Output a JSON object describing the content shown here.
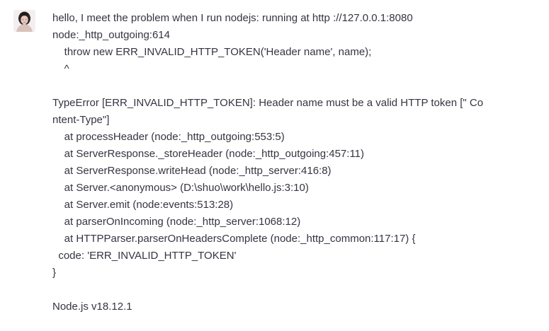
{
  "user": {
    "avatar_icon": "user-avatar-icon"
  },
  "message": {
    "lines": [
      "hello, I meet the problem when I run nodejs: running at http ://127.0.0.1:8080",
      "node:_http_outgoing:614",
      "    throw new ERR_INVALID_HTTP_TOKEN('Header name', name);",
      "    ^",
      "",
      "TypeError [ERR_INVALID_HTTP_TOKEN]: Header name must be a valid HTTP token [\" Co",
      "ntent-Type\"]",
      "    at processHeader (node:_http_outgoing:553:5)",
      "    at ServerResponse._storeHeader (node:_http_outgoing:457:11)",
      "    at ServerResponse.writeHead (node:_http_server:416:8)",
      "    at Server.<anonymous> (D:\\shuo\\work\\hello.js:3:10)",
      "    at Server.emit (node:events:513:28)",
      "    at parserOnIncoming (node:_http_server:1068:12)",
      "    at HTTPParser.parserOnHeadersComplete (node:_http_common:117:17) {",
      "  code: 'ERR_INVALID_HTTP_TOKEN'",
      "}",
      "",
      "Node.js v18.12.1"
    ]
  }
}
